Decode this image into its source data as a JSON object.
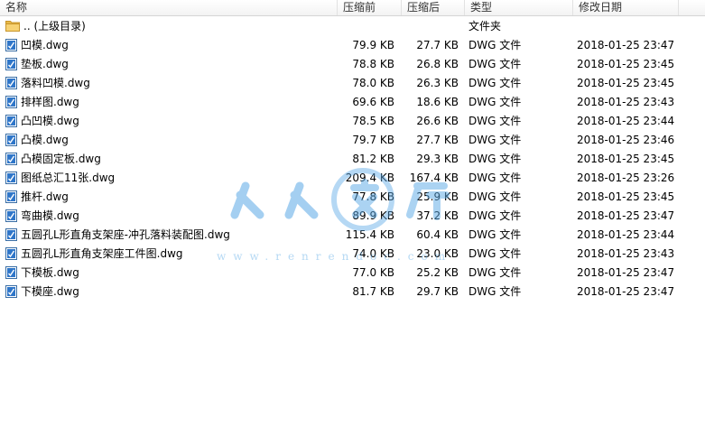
{
  "columns": {
    "name": "名称",
    "compressed": "压缩前",
    "original": "压缩后",
    "type": "类型",
    "modified": "修改日期"
  },
  "parent_row": {
    "name": ".. (上级目录)",
    "type": "文件夹",
    "icon": "folder-icon"
  },
  "files": [
    {
      "name": "凹模.dwg",
      "compressed": "79.9 KB",
      "original": "27.7 KB",
      "type": "DWG 文件",
      "modified": "2018-01-25 23:47"
    },
    {
      "name": "垫板.dwg",
      "compressed": "78.8 KB",
      "original": "26.8 KB",
      "type": "DWG 文件",
      "modified": "2018-01-25 23:45"
    },
    {
      "name": "落料凹模.dwg",
      "compressed": "78.0 KB",
      "original": "26.3 KB",
      "type": "DWG 文件",
      "modified": "2018-01-25 23:45"
    },
    {
      "name": "排样图.dwg",
      "compressed": "69.6 KB",
      "original": "18.6 KB",
      "type": "DWG 文件",
      "modified": "2018-01-25 23:43"
    },
    {
      "name": "凸凹模.dwg",
      "compressed": "78.5 KB",
      "original": "26.6 KB",
      "type": "DWG 文件",
      "modified": "2018-01-25 23:44"
    },
    {
      "name": "凸模.dwg",
      "compressed": "79.7 KB",
      "original": "27.7 KB",
      "type": "DWG 文件",
      "modified": "2018-01-25 23:46"
    },
    {
      "name": "凸模固定板.dwg",
      "compressed": "81.2 KB",
      "original": "29.3 KB",
      "type": "DWG 文件",
      "modified": "2018-01-25 23:45"
    },
    {
      "name": "图纸总汇11张.dwg",
      "compressed": "209.4 KB",
      "original": "167.4 KB",
      "type": "DWG 文件",
      "modified": "2018-01-25 23:26"
    },
    {
      "name": "推杆.dwg",
      "compressed": "77.8 KB",
      "original": "25.9 KB",
      "type": "DWG 文件",
      "modified": "2018-01-25 23:45"
    },
    {
      "name": "弯曲模.dwg",
      "compressed": "89.9 KB",
      "original": "37.2 KB",
      "type": "DWG 文件",
      "modified": "2018-01-25 23:47"
    },
    {
      "name": "五圆孔L形直角支架座-冲孔落料装配图.dwg",
      "compressed": "115.4 KB",
      "original": "60.4 KB",
      "type": "DWG 文件",
      "modified": "2018-01-25 23:44"
    },
    {
      "name": "五圆孔L形直角支架座工件图.dwg",
      "compressed": "74.0 KB",
      "original": "23.0 KB",
      "type": "DWG 文件",
      "modified": "2018-01-25 23:43"
    },
    {
      "name": "下模板.dwg",
      "compressed": "77.0 KB",
      "original": "25.2 KB",
      "type": "DWG 文件",
      "modified": "2018-01-25 23:47"
    },
    {
      "name": "下模座.dwg",
      "compressed": "81.7 KB",
      "original": "29.7 KB",
      "type": "DWG 文件",
      "modified": "2018-01-25 23:47"
    }
  ],
  "file_icon": "dwg-file-icon",
  "watermark": {
    "logo_text": "人人文库",
    "url_text": "www.renrendoc.com",
    "color": "#5aa9e6"
  }
}
